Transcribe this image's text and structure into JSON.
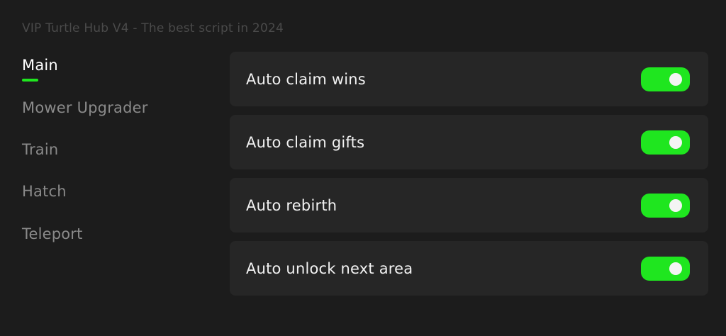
{
  "window": {
    "title": "VIP Turtle Hub V4 - The best script in 2024"
  },
  "sidebar": {
    "items": [
      {
        "label": "Main",
        "active": true
      },
      {
        "label": "Mower Upgrader",
        "active": false
      },
      {
        "label": "Train",
        "active": false
      },
      {
        "label": "Hatch",
        "active": false
      },
      {
        "label": "Teleport",
        "active": false
      }
    ]
  },
  "main": {
    "toggles": [
      {
        "label": "Auto claim wins",
        "enabled": true
      },
      {
        "label": "Auto claim gifts",
        "enabled": true
      },
      {
        "label": "Auto rebirth",
        "enabled": true
      },
      {
        "label": "Auto unlock next area",
        "enabled": true
      }
    ]
  },
  "colors": {
    "accent": "#1fe61f",
    "background": "#1c1c1c",
    "card": "#262626",
    "text_primary": "#f2f2f2",
    "text_secondary": "#8a8a8a",
    "title_text": "#4a4a4a"
  }
}
